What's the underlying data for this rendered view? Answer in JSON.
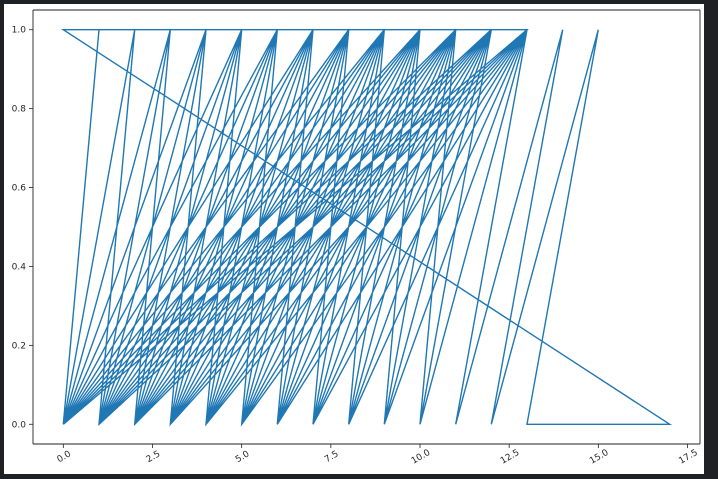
{
  "chart_data": {
    "type": "line",
    "title": "",
    "xlabel": "",
    "ylabel": "",
    "xlim": [
      -0.85,
      17.85
    ],
    "ylim": [
      -0.05,
      1.05
    ],
    "x_ticks": [
      "0.0",
      "2.5",
      "5.0",
      "7.5",
      "10.0",
      "12.5",
      "15.0",
      "17.5"
    ],
    "y_ticks": [
      "0.0",
      "0.2",
      "0.4",
      "0.6",
      "0.8",
      "1.0"
    ],
    "grid": false,
    "legend": "none",
    "series": [
      {
        "color": "#1f77b4",
        "note_levels": "points alternate between y=0 and y=1, zig-zagging across x = 0..13 with excursions to 14, 15 and 17 at y=1",
        "x": [
          0,
          1,
          0,
          2,
          0,
          3,
          0,
          4,
          0,
          5,
          0,
          6,
          0,
          7,
          0,
          8,
          0,
          9,
          0,
          10,
          0,
          11,
          0,
          12,
          0,
          13,
          1,
          2,
          1,
          3,
          1,
          4,
          1,
          5,
          1,
          6,
          1,
          7,
          1,
          8,
          1,
          9,
          1,
          10,
          1,
          11,
          1,
          12,
          1,
          13,
          2,
          3,
          2,
          4,
          2,
          5,
          2,
          6,
          2,
          7,
          2,
          8,
          2,
          9,
          2,
          10,
          2,
          11,
          2,
          12,
          2,
          13,
          3,
          4,
          3,
          5,
          3,
          6,
          3,
          7,
          3,
          8,
          3,
          9,
          3,
          10,
          3,
          11,
          3,
          12,
          3,
          13,
          4,
          5,
          4,
          6,
          4,
          7,
          4,
          8,
          4,
          9,
          4,
          10,
          4,
          11,
          4,
          12,
          4,
          13,
          5,
          6,
          5,
          7,
          5,
          8,
          5,
          9,
          5,
          10,
          5,
          11,
          5,
          12,
          5,
          13,
          6,
          7,
          6,
          8,
          6,
          9,
          6,
          10,
          6,
          11,
          6,
          12,
          6,
          13,
          7,
          8,
          7,
          9,
          7,
          10,
          7,
          11,
          7,
          12,
          7,
          13,
          8,
          9,
          8,
          10,
          8,
          11,
          8,
          12,
          8,
          13,
          9,
          10,
          9,
          11,
          9,
          12,
          9,
          13,
          10,
          11,
          10,
          12,
          10,
          13,
          11,
          14,
          12,
          15,
          13,
          17,
          0,
          13,
          0
        ],
        "y": [
          0,
          1,
          0,
          1,
          0,
          1,
          0,
          1,
          0,
          1,
          0,
          1,
          0,
          1,
          0,
          1,
          0,
          1,
          0,
          1,
          0,
          1,
          0,
          1,
          0,
          1,
          0,
          1,
          0,
          1,
          0,
          1,
          0,
          1,
          0,
          1,
          0,
          1,
          0,
          1,
          0,
          1,
          0,
          1,
          0,
          1,
          0,
          1,
          0,
          1,
          0,
          1,
          0,
          1,
          0,
          1,
          0,
          1,
          0,
          1,
          0,
          1,
          0,
          1,
          0,
          1,
          0,
          1,
          0,
          1,
          0,
          1,
          0,
          1,
          0,
          1,
          0,
          1,
          0,
          1,
          0,
          1,
          0,
          1,
          0,
          1,
          0,
          1,
          0,
          1,
          0,
          1,
          0,
          1,
          0,
          1,
          0,
          1,
          0,
          1,
          0,
          1,
          0,
          1,
          0,
          1,
          0,
          1,
          0,
          1,
          0,
          1,
          0,
          1,
          0,
          1,
          0,
          1,
          0,
          1,
          0,
          1,
          0,
          1,
          0,
          1,
          0,
          1,
          0,
          1,
          0,
          1,
          0,
          1,
          0,
          1,
          0,
          1,
          0,
          1,
          0,
          1,
          0,
          1,
          0,
          1,
          0,
          1,
          0,
          1,
          0,
          1,
          0,
          1,
          0,
          1,
          0,
          1,
          0,
          1,
          0,
          1,
          0,
          1,
          0,
          1,
          0,
          1,
          0,
          1,
          0,
          1,
          0,
          1,
          0,
          1,
          0,
          1,
          0,
          1,
          0,
          0,
          1,
          1,
          0
        ]
      }
    ]
  }
}
